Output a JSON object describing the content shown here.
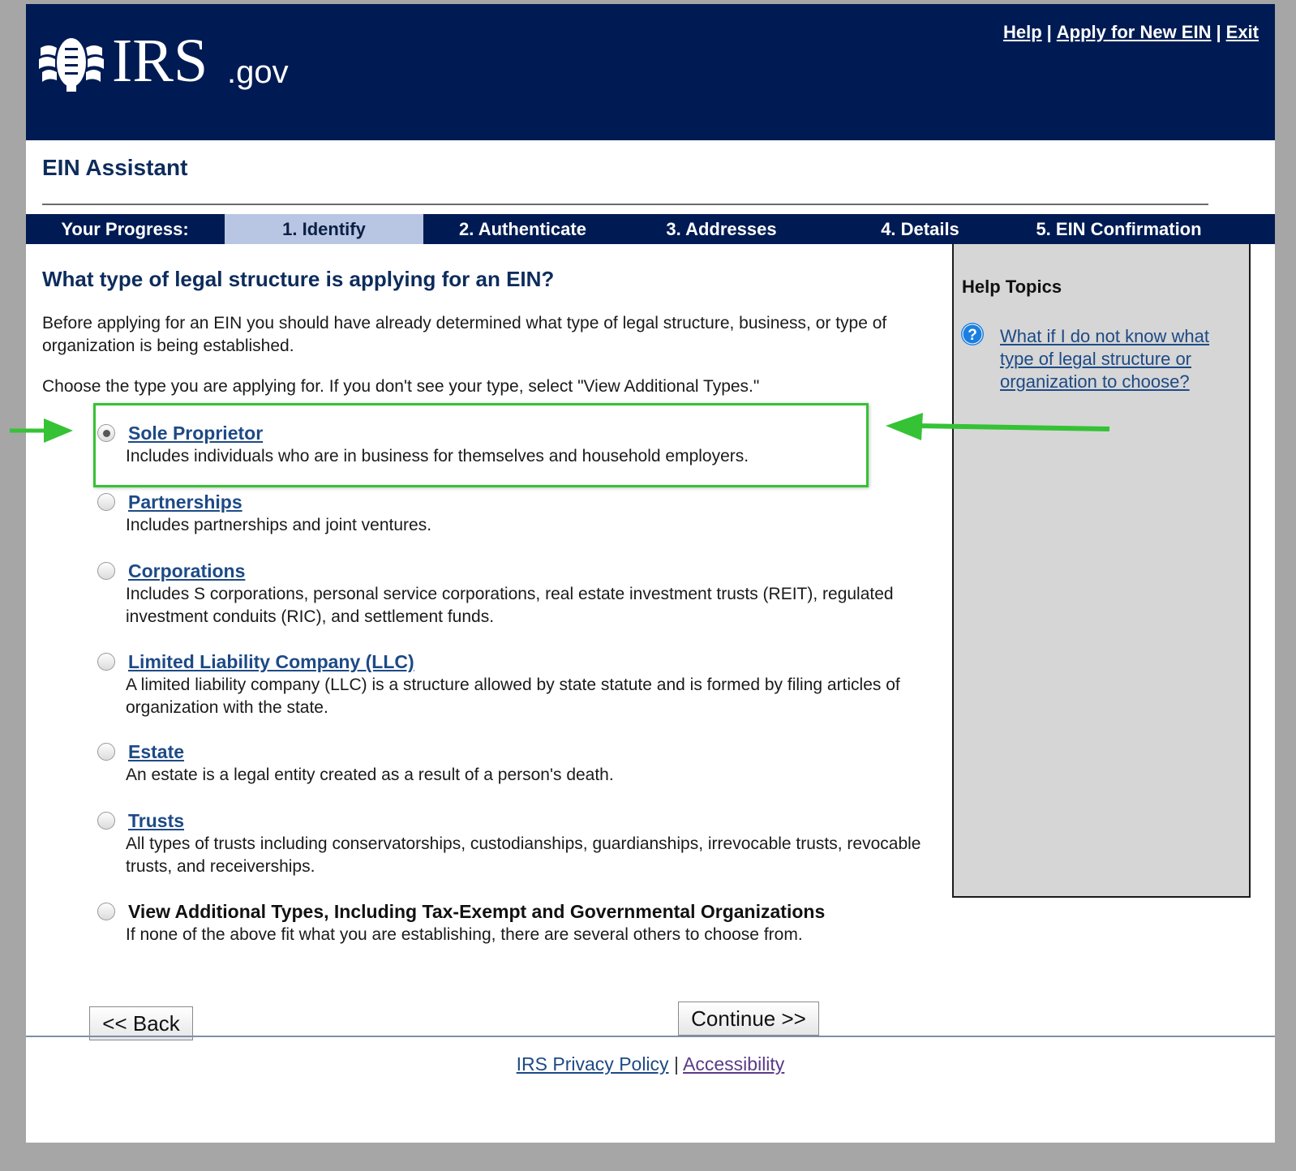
{
  "header": {
    "logo_text": "IRS",
    "logo_suffix": ".gov",
    "links": {
      "help": "Help",
      "apply": "Apply for New EIN",
      "exit": "Exit",
      "separator": "|"
    }
  },
  "assistant_title": "EIN Assistant",
  "progress": {
    "label": "Your Progress:",
    "steps": [
      "1. Identify",
      "2. Authenticate",
      "3. Addresses",
      "4. Details",
      "5. EIN Confirmation"
    ],
    "active_step": "1. Identify"
  },
  "question": "What type of legal structure is applying for an EIN?",
  "intro": "Before applying for an EIN you should have already determined what type of legal structure, business, or type of organization is being established.",
  "choose_text": "Choose the type you are applying for. If you don't see your type, select \"View Additional Types.\"",
  "options": [
    {
      "title": "Sole Proprietor",
      "desc": "Includes individuals who are in business for themselves and household employers.",
      "selected": true
    },
    {
      "title": "Partnerships",
      "desc": "Includes partnerships and joint ventures.",
      "selected": false
    },
    {
      "title": "Corporations",
      "desc": "Includes S corporations, personal service corporations, real estate investment trusts (REIT), regulated investment conduits (RIC), and settlement funds.",
      "selected": false
    },
    {
      "title": "Limited Liability Company (LLC)",
      "desc": "A limited liability company (LLC) is a structure allowed by state statute and is formed by filing articles of organization with the state.",
      "selected": false
    },
    {
      "title": "Estate",
      "desc": "An estate is a legal entity created as a result of a person's death.",
      "selected": false
    },
    {
      "title": "Trusts",
      "desc": "All types of trusts including conservatorships, custodianships, guardianships, irrevocable trusts, revocable trusts, and receiverships.",
      "selected": false
    },
    {
      "title": "View Additional Types, Including Tax-Exempt and Governmental Organizations",
      "desc": "If none of the above fit what you are establishing, there are several others to choose from.",
      "selected": false
    }
  ],
  "sidebar": {
    "title": "Help Topics",
    "link": "What if I do not know what type of legal structure or organization to choose?"
  },
  "buttons": {
    "back": "<< Back",
    "continue": "Continue >>"
  },
  "footer": {
    "privacy": "IRS Privacy Policy",
    "separator": "|",
    "accessibility": "Accessibility"
  },
  "colors": {
    "header_bg": "#001b53",
    "active_step_bg": "#b8c6e3",
    "link": "#1d4a86",
    "highlight_green": "#35c235",
    "sidebar_bg": "#d6d6d6"
  }
}
